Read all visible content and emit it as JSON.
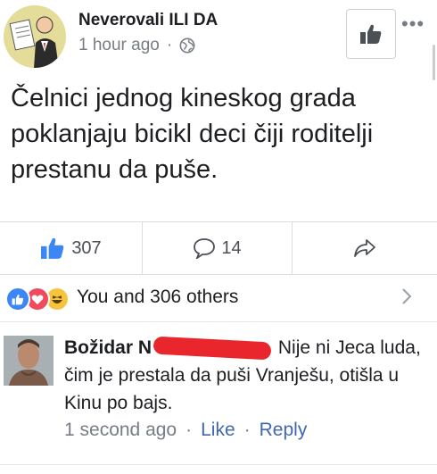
{
  "post": {
    "page_name": "Neverovali ILI DA",
    "timestamp": "1 hour ago",
    "separator": "·",
    "privacy_icon": "globe-icon",
    "text": "Čelnici jednog kineskog grada poklanjaju bicikl deci čiji roditelji prestanu da puše."
  },
  "actions": {
    "like_count": "307",
    "comment_count": "14",
    "like_icon": "thumbs-up-icon",
    "comment_icon": "speech-bubble-icon",
    "share_icon": "share-arrow-icon"
  },
  "reactions": {
    "summary": "You and 306 others",
    "icons": [
      "like-reaction-icon",
      "love-reaction-icon",
      "haha-reaction-icon"
    ]
  },
  "comment": {
    "author": "Božidar",
    "author_tail": "N",
    "text": "Nije ni Jeca luda, čim je prestala da puši Vranješu, otišla u Kinu po bajs.",
    "timestamp": "1 second ago",
    "like_label": "Like",
    "reply_label": "Reply",
    "separator": "·"
  },
  "colors": {
    "accent": "#4267b2",
    "like_blue": "#3b87f5",
    "love_red": "#ef4a5e",
    "haha_yellow": "#f7c53d",
    "redaction": "#e8262b"
  }
}
